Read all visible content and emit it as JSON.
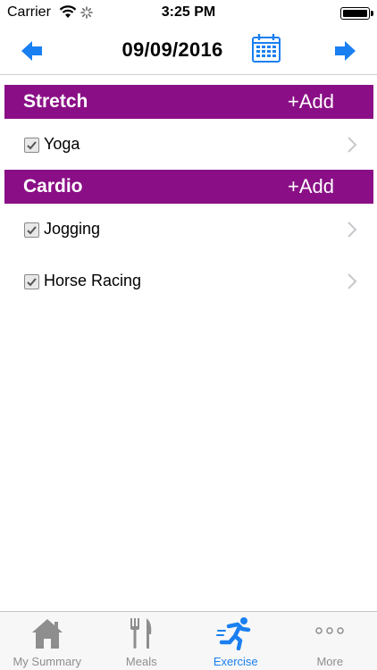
{
  "status": {
    "carrier": "Carrier",
    "time": "3:25 PM"
  },
  "nav": {
    "date": "09/09/2016"
  },
  "sections": [
    {
      "title": "Stretch",
      "add_label": "+Add",
      "items": [
        {
          "label": "Yoga",
          "checked": true
        }
      ]
    },
    {
      "title": "Cardio",
      "add_label": "+Add",
      "items": [
        {
          "label": "Jogging",
          "checked": true
        },
        {
          "label": "Horse Racing",
          "checked": true
        }
      ]
    }
  ],
  "tabs": [
    {
      "label": "My Summary",
      "icon": "house-icon",
      "active": false
    },
    {
      "label": "Meals",
      "icon": "fork-knife-icon",
      "active": false
    },
    {
      "label": "Exercise",
      "icon": "runner-icon",
      "active": true
    },
    {
      "label": "More",
      "icon": "more-dots-icon",
      "active": false
    }
  ],
  "colors": {
    "section_header": "#8a0f86",
    "accent": "#1a7ff0",
    "inactive_tab": "#8e8e8e"
  }
}
